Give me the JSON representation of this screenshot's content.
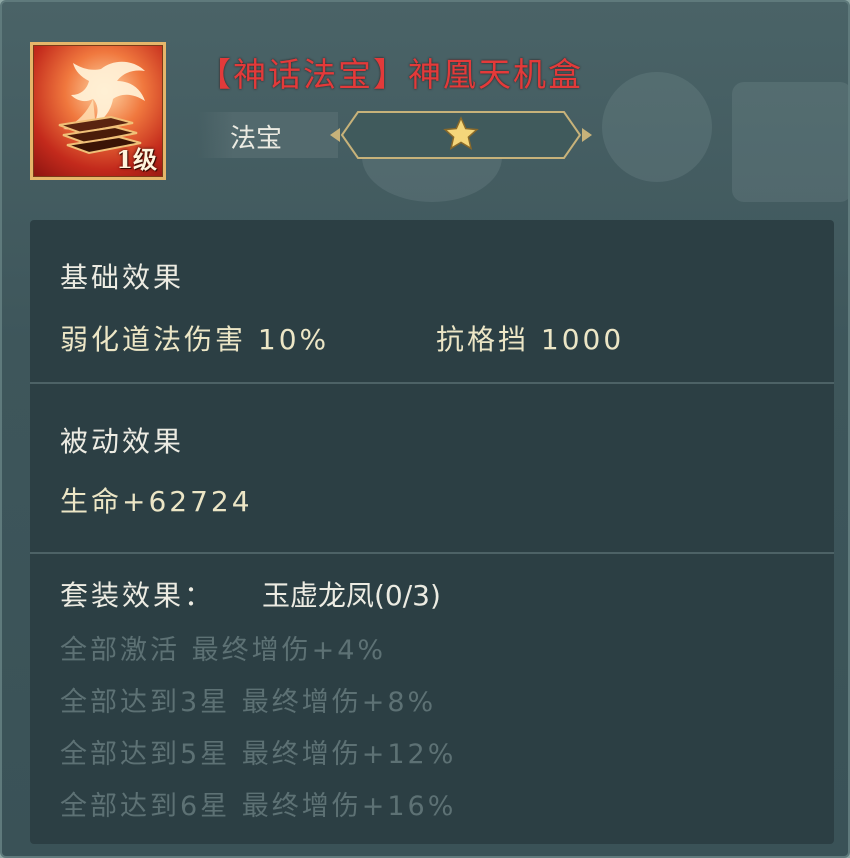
{
  "header": {
    "item_title": "【神话法宝】神凰天机盒",
    "item_level": "1级",
    "item_type": "法宝",
    "item_icon": "phoenix-box-icon",
    "star_icon": "gold-star-icon",
    "star_count": 1,
    "title_color": "#e33a3a",
    "star_color": "#f5d67a"
  },
  "base_effect": {
    "title": "基础效果",
    "stats": [
      "弱化道法伤害 10%",
      "抗格挡 1000"
    ]
  },
  "passive_effect": {
    "title": "被动效果",
    "stats": [
      "生命+62724"
    ]
  },
  "set_effect": {
    "title": "套装效果：",
    "set_name": "玉虚龙凤(0/3)",
    "bonuses": [
      "全部激活 最终增伤+4%",
      "全部达到3星 最终增伤+8%",
      "全部达到5星 最终增伤+12%",
      "全部达到6星 最终增伤+16%"
    ]
  }
}
